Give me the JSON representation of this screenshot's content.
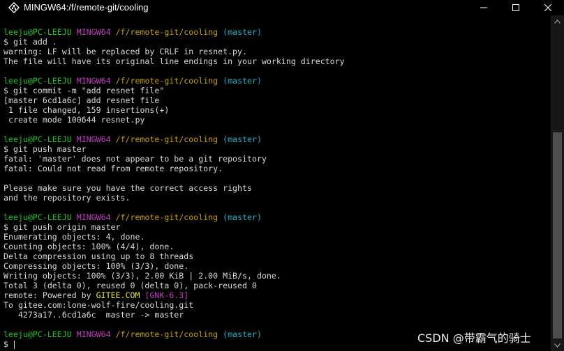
{
  "window": {
    "title": "MINGW64:/f/remote-git/cooling",
    "icons": {
      "app": "git-bash-diamond-icon",
      "minimize": "minimize-icon",
      "maximize": "maximize-icon",
      "close": "close-icon"
    }
  },
  "prompt": {
    "user": "leeju@PC-LEEJU",
    "host": "MINGW64",
    "path": "/f/remote-git/cooling",
    "branch": "(master)"
  },
  "blocks": [
    {
      "command": "$ git add .",
      "output": [
        "warning: LF will be replaced by CRLF in resnet.py.",
        "The file will have its original line endings in your working directory"
      ]
    },
    {
      "command": "$ git commit -m \"add resnet file\"",
      "output": [
        "[master 6cd1a6c] add resnet file",
        " 1 file changed, 159 insertions(+)",
        " create mode 100644 resnet.py"
      ]
    },
    {
      "command": "$ git push master",
      "output": [
        "fatal: 'master' does not appear to be a git repository",
        "fatal: Could not read from remote repository.",
        "",
        "Please make sure you have the correct access rights",
        "and the repository exists."
      ]
    },
    {
      "command": "$ git push origin master",
      "output": [
        "Enumerating objects: 4, done.",
        "Counting objects: 100% (4/4), done.",
        "Delta compression using up to 8 threads",
        "Compressing objects: 100% (3/3), done.",
        "Writing objects: 100% (3/3), 2.00 KiB | 2.00 MiB/s, done.",
        "Total 3 (delta 0), reused 0 (delta 0), pack-reused 0"
      ],
      "remote_line": {
        "prefix": "remote: Powered by ",
        "gitee": "GITEE.COM",
        "gap": " ",
        "gnk": "[GNK-6.3]"
      },
      "tail": [
        "To gitee.com:lone-wolf-fire/cooling.git",
        "   4273a17..6cd1a6c  master -> master"
      ]
    }
  ],
  "final_command": "$ ",
  "watermark": "CSDN @带霸气的骑士",
  "colors": {
    "background": "#000000",
    "text": "#d8d8d8",
    "user": "#1fc52a",
    "host": "#c23ec2",
    "path": "#c4a000",
    "branch": "#21b0c8",
    "gitee": "#e8e83a"
  }
}
